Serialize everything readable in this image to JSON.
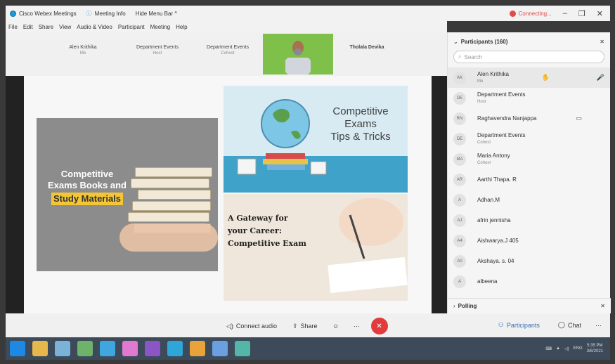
{
  "titlebar": {
    "app_name": "Cisco Webex Meetings",
    "meeting_info": "Meeting Info",
    "hide_menu": "Hide Menu Bar ^",
    "status": "Connecting...",
    "status_color": "#e14b4b"
  },
  "menu": [
    "File",
    "Edit",
    "Share",
    "View",
    "Audio & Video",
    "Participant",
    "Meeting",
    "Help"
  ],
  "strip": {
    "tiles": [
      {
        "name": "Alen Krithika",
        "role": "Me"
      },
      {
        "name": "Department Events",
        "role": "Host"
      },
      {
        "name": "Department Events",
        "role": "Cohost"
      },
      {
        "name": "Tholala Devika",
        "role": ""
      }
    ]
  },
  "slide": {
    "books_line1": "Competitive",
    "books_line2": "Exams Books and",
    "books_line3": "Study Materials",
    "globe_line1": "Competitive Exams",
    "globe_line2": "Tips & Tricks",
    "write_line1": "A Gateway for",
    "write_line2": "your Career:",
    "write_line3": "Competitive Exam"
  },
  "panel": {
    "title": "Participants (160)",
    "search_placeholder": "Search",
    "participants": [
      {
        "initials": "AK",
        "name": "Alen Krithika",
        "role": "Me"
      },
      {
        "initials": "DE",
        "name": "Department Events",
        "role": "Host"
      },
      {
        "initials": "RN",
        "name": "Raghavendra Nanjappa",
        "role": ""
      },
      {
        "initials": "DE",
        "name": "Department Events",
        "role": "Cohost"
      },
      {
        "initials": "MA",
        "name": "Maria Antony",
        "role": "Cohost"
      },
      {
        "initials": "AR",
        "name": "Aarthi Thapa. R",
        "role": ""
      },
      {
        "initials": "A",
        "name": "Adhan.M",
        "role": ""
      },
      {
        "initials": "AJ",
        "name": "afrin jennisha",
        "role": ""
      },
      {
        "initials": "A4",
        "name": "Aishwarya.J 405",
        "role": ""
      },
      {
        "initials": "A0",
        "name": "Akshaya. s. 04",
        "role": ""
      },
      {
        "initials": "A",
        "name": "albeena",
        "role": ""
      }
    ],
    "polling": "Polling"
  },
  "controls": {
    "connect_audio": "Connect audio",
    "share": "Share",
    "participants": "Participants",
    "chat": "Chat",
    "end_color": "#e23b3b"
  },
  "taskbar": {
    "time": "5:35 PM",
    "date": "3/6/2021",
    "lang": "ENG"
  }
}
